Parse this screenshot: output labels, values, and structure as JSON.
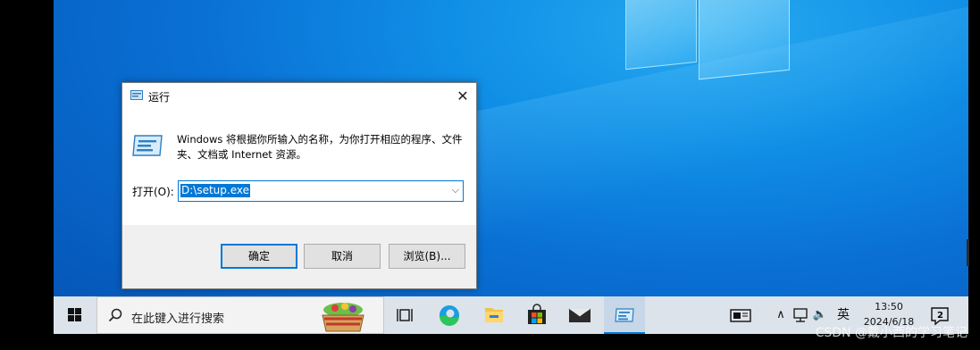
{
  "dialog": {
    "title": "运行",
    "description": "Windows 将根据你所输入的名称，为你打开相应的程序、文件夹、文档或 Internet 资源。",
    "open_label": "打开(O):",
    "open_value": "D:\\setup.exe",
    "ok_label": "确定",
    "cancel_label": "取消",
    "browse_label": "浏览(B)...",
    "close_glyph": "✕",
    "combo_arrow": "⌵"
  },
  "taskbar": {
    "search_placeholder": "在此键入进行搜索",
    "apps": [
      "task-view",
      "edge",
      "file-explorer",
      "microsoft-store",
      "mail",
      "run"
    ],
    "tray_up_glyph": "∧",
    "volume_glyph": "🔈",
    "ime": "英",
    "time": "13:50",
    "date": "2024/6/18",
    "notification_count": "2"
  },
  "watermark": "CSDN @戴小西的学习笔记",
  "colors": {
    "accent": "#0078d7",
    "taskbar": "#dce3ea",
    "desktop_blue": "#0a70d4"
  }
}
